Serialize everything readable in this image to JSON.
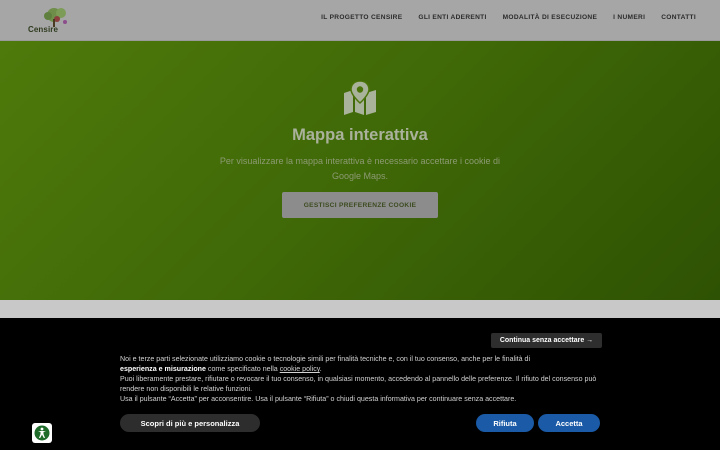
{
  "header": {
    "logo_text": "Censire",
    "nav": [
      {
        "label": "IL PROGETTO CENSIRE"
      },
      {
        "label": "GLI ENTI ADERENTI"
      },
      {
        "label": "MODALITÀ DI ESECUZIONE"
      },
      {
        "label": "I NUMERI"
      },
      {
        "label": "CONTATTI"
      }
    ]
  },
  "hero": {
    "icon": "map-marker-icon",
    "title": "Mappa interattiva",
    "description": "Per visualizzare la mappa interattiva è necessario accettare i cookie di Google Maps.",
    "button_label": "GESTISCI PREFERENZE COOKIE"
  },
  "cookie_banner": {
    "continue_label": "Continua senza accettare →",
    "text_1": "Noi e terze parti selezionate utilizziamo cookie o tecnologie simili per finalità tecniche e, con il tuo consenso, anche per le finalità di",
    "text_bold": "esperienza e misurazione",
    "text_2": " come specificato nella ",
    "text_link": "cookie policy",
    "text_3": ".",
    "text_4": "Puoi liberamente prestare, rifiutare o revocare il tuo consenso, in qualsiasi momento, accedendo al pannello delle preferenze. Il rifiuto del consenso può rendere non disponibili le relative funzioni.",
    "text_5": "Usa il pulsante “Accetta” per acconsentire. Usa il pulsante “Rifiuta” o chiudi questa informativa per continuare senza accettare.",
    "more_label": "Scopri di più e personalizza",
    "reject_label": "Rifiuta",
    "accept_label": "Accetta"
  },
  "accessibility": {
    "icon": "accessibility-icon"
  },
  "colors": {
    "hero_green": "#4e7a0b",
    "button_blue": "#1a5aa6",
    "banner_bg": "#000000"
  }
}
